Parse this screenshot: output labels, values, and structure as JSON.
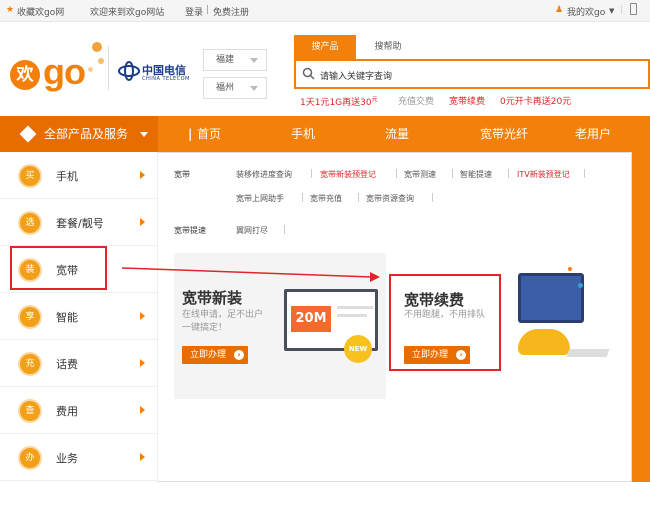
{
  "topbar": {
    "favorite": "收藏欢go网",
    "welcome": "欢迎来到欢go网站",
    "login": "登录",
    "sep": "|",
    "register": "免费注册",
    "my_huango": "我的欢go"
  },
  "header": {
    "logo_char": "欢",
    "logo_text": "go",
    "telecom_cn": "中国电信",
    "telecom_en": "CHINA TELECOM",
    "province": "福建",
    "city": "福州",
    "search_tab_products": "搜产品",
    "search_tab_help": "搜帮助",
    "search_placeholder": "请输入关键字查询",
    "hot_links": [
      "1天1元1G再送30",
      "充值交费",
      "宽带续费",
      "0元开卡再送20元"
    ],
    "hot_sup": "元"
  },
  "nav": {
    "all_products": "全部产品及服务",
    "items": [
      "首页",
      "手机",
      "流量",
      "宽带光纤",
      "老用户"
    ]
  },
  "sidebar": {
    "items": [
      {
        "icon": "买",
        "label": "手机"
      },
      {
        "icon": "选",
        "label": "套餐/靓号"
      },
      {
        "icon": "装",
        "label": "宽带"
      },
      {
        "icon": "享",
        "label": "智能"
      },
      {
        "icon": "充",
        "label": "话费"
      },
      {
        "icon": "查",
        "label": "费用"
      },
      {
        "icon": "办",
        "label": "业务"
      }
    ]
  },
  "panel": {
    "row1_label": "宽带",
    "row1_links": [
      "装移修进度查询",
      "宽带新装预登记",
      "宽带测速",
      "智能提速",
      "ITV新装预登记"
    ],
    "row1_links_b": [
      "宽带上网助手",
      "宽带充值",
      "宽带资源查询"
    ],
    "row2_label": "宽带提速",
    "row2_links": [
      "翼网打尽"
    ],
    "banner1": {
      "title": "宽带新装",
      "desc1": "在线申请，足不出户",
      "desc2": "一键搞定！",
      "button": "立即办理",
      "badge": "20M",
      "new_tag": "NEW"
    },
    "banner2": {
      "title": "宽带续费",
      "desc": "不用跑腿，不用排队",
      "button": "立即办理"
    }
  },
  "colors": {
    "brand": "#f2800a",
    "brand_dark": "#e86d00",
    "link_red": "#e0252b",
    "annotation_red": "#e0252b"
  }
}
